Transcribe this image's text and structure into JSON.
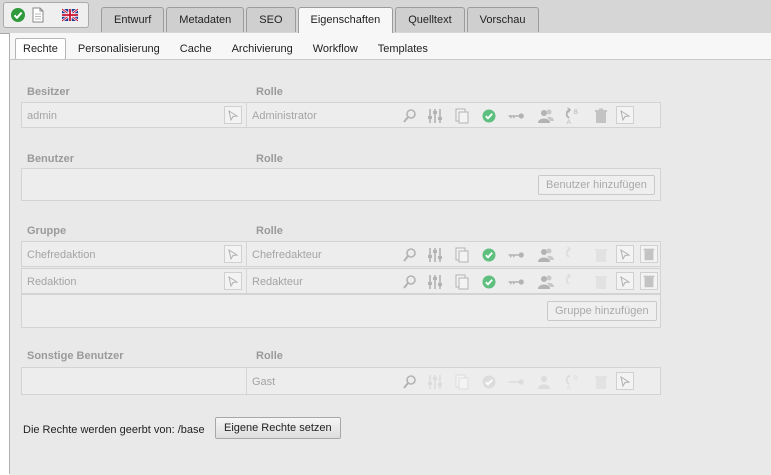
{
  "toolbar": {
    "icons": [
      "check-icon",
      "page-icon",
      "uk-flag-icon"
    ]
  },
  "tabs": [
    {
      "label": "Entwurf",
      "active": false
    },
    {
      "label": "Metadaten",
      "active": false
    },
    {
      "label": "SEO",
      "active": false
    },
    {
      "label": "Eigenschaften",
      "active": true
    },
    {
      "label": "Quelltext",
      "active": false
    },
    {
      "label": "Vorschau",
      "active": false
    }
  ],
  "subtabs": [
    {
      "label": "Rechte",
      "active": true
    },
    {
      "label": "Personalisierung",
      "active": false
    },
    {
      "label": "Cache",
      "active": false
    },
    {
      "label": "Archivierung",
      "active": false
    },
    {
      "label": "Workflow",
      "active": false
    },
    {
      "label": "Templates",
      "active": false
    }
  ],
  "owner": {
    "header": "Besitzer",
    "role_header": "Rolle",
    "name": "admin",
    "role": "Administrator"
  },
  "users": {
    "header": "Benutzer",
    "role_header": "Rolle",
    "add_label": "Benutzer hinzufügen"
  },
  "groups": {
    "header": "Gruppe",
    "role_header": "Rolle",
    "rows": [
      {
        "name": "Chefredaktion",
        "role": "Chefredakteur"
      },
      {
        "name": "Redaktion",
        "role": "Redakteur"
      }
    ],
    "add_label": "Gruppe hinzufügen"
  },
  "others": {
    "header": "Sonstige Benutzer",
    "role_header": "Rolle",
    "name": "",
    "role": "Gast"
  },
  "inherit_text": "Die Rechte werden geerbt von: /base",
  "own_rights_label": "Eigene Rechte setzen",
  "colors": {
    "check_green": "#4caf6e",
    "muted_icon": "#b3b3b3",
    "tab_bg": "#cfcfcf"
  }
}
